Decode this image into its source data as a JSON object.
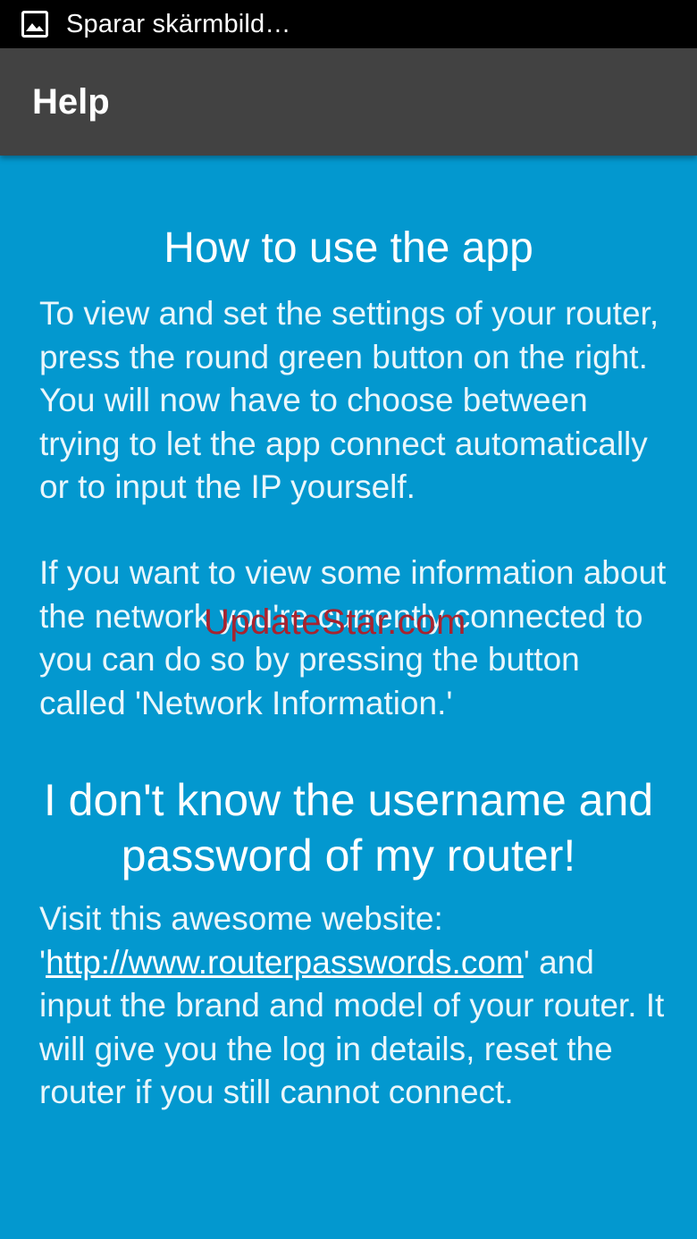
{
  "status_bar": {
    "notification_icon": "image-icon",
    "text": "Sparar skärmbild…"
  },
  "app_bar": {
    "title": "Help"
  },
  "section_1": {
    "heading": "How to use the app",
    "paragraph_1": "To view and set the settings of your router, press the round green button on the right. You will now have to choose between trying to let the app connect automatically or to input the IP yourself.",
    "paragraph_2": "If you want to view some information about the network you're currently connected to you can do so by pressing the button called 'Network Information.'"
  },
  "section_2": {
    "heading": "I don't know the username and password of my router!",
    "text_before_link": "Visit this awesome website: '",
    "link_text": "http://www.routerpasswords.com",
    "text_after_link": "' and input the brand and model of your router. It will give you the log in details, reset the router if you still cannot connect."
  },
  "watermark": {
    "text": "UpdateStar.com"
  },
  "colors": {
    "background": "#0398cf",
    "app_bar": "#424242",
    "status_bar": "#000000",
    "watermark": "#a8232f"
  }
}
